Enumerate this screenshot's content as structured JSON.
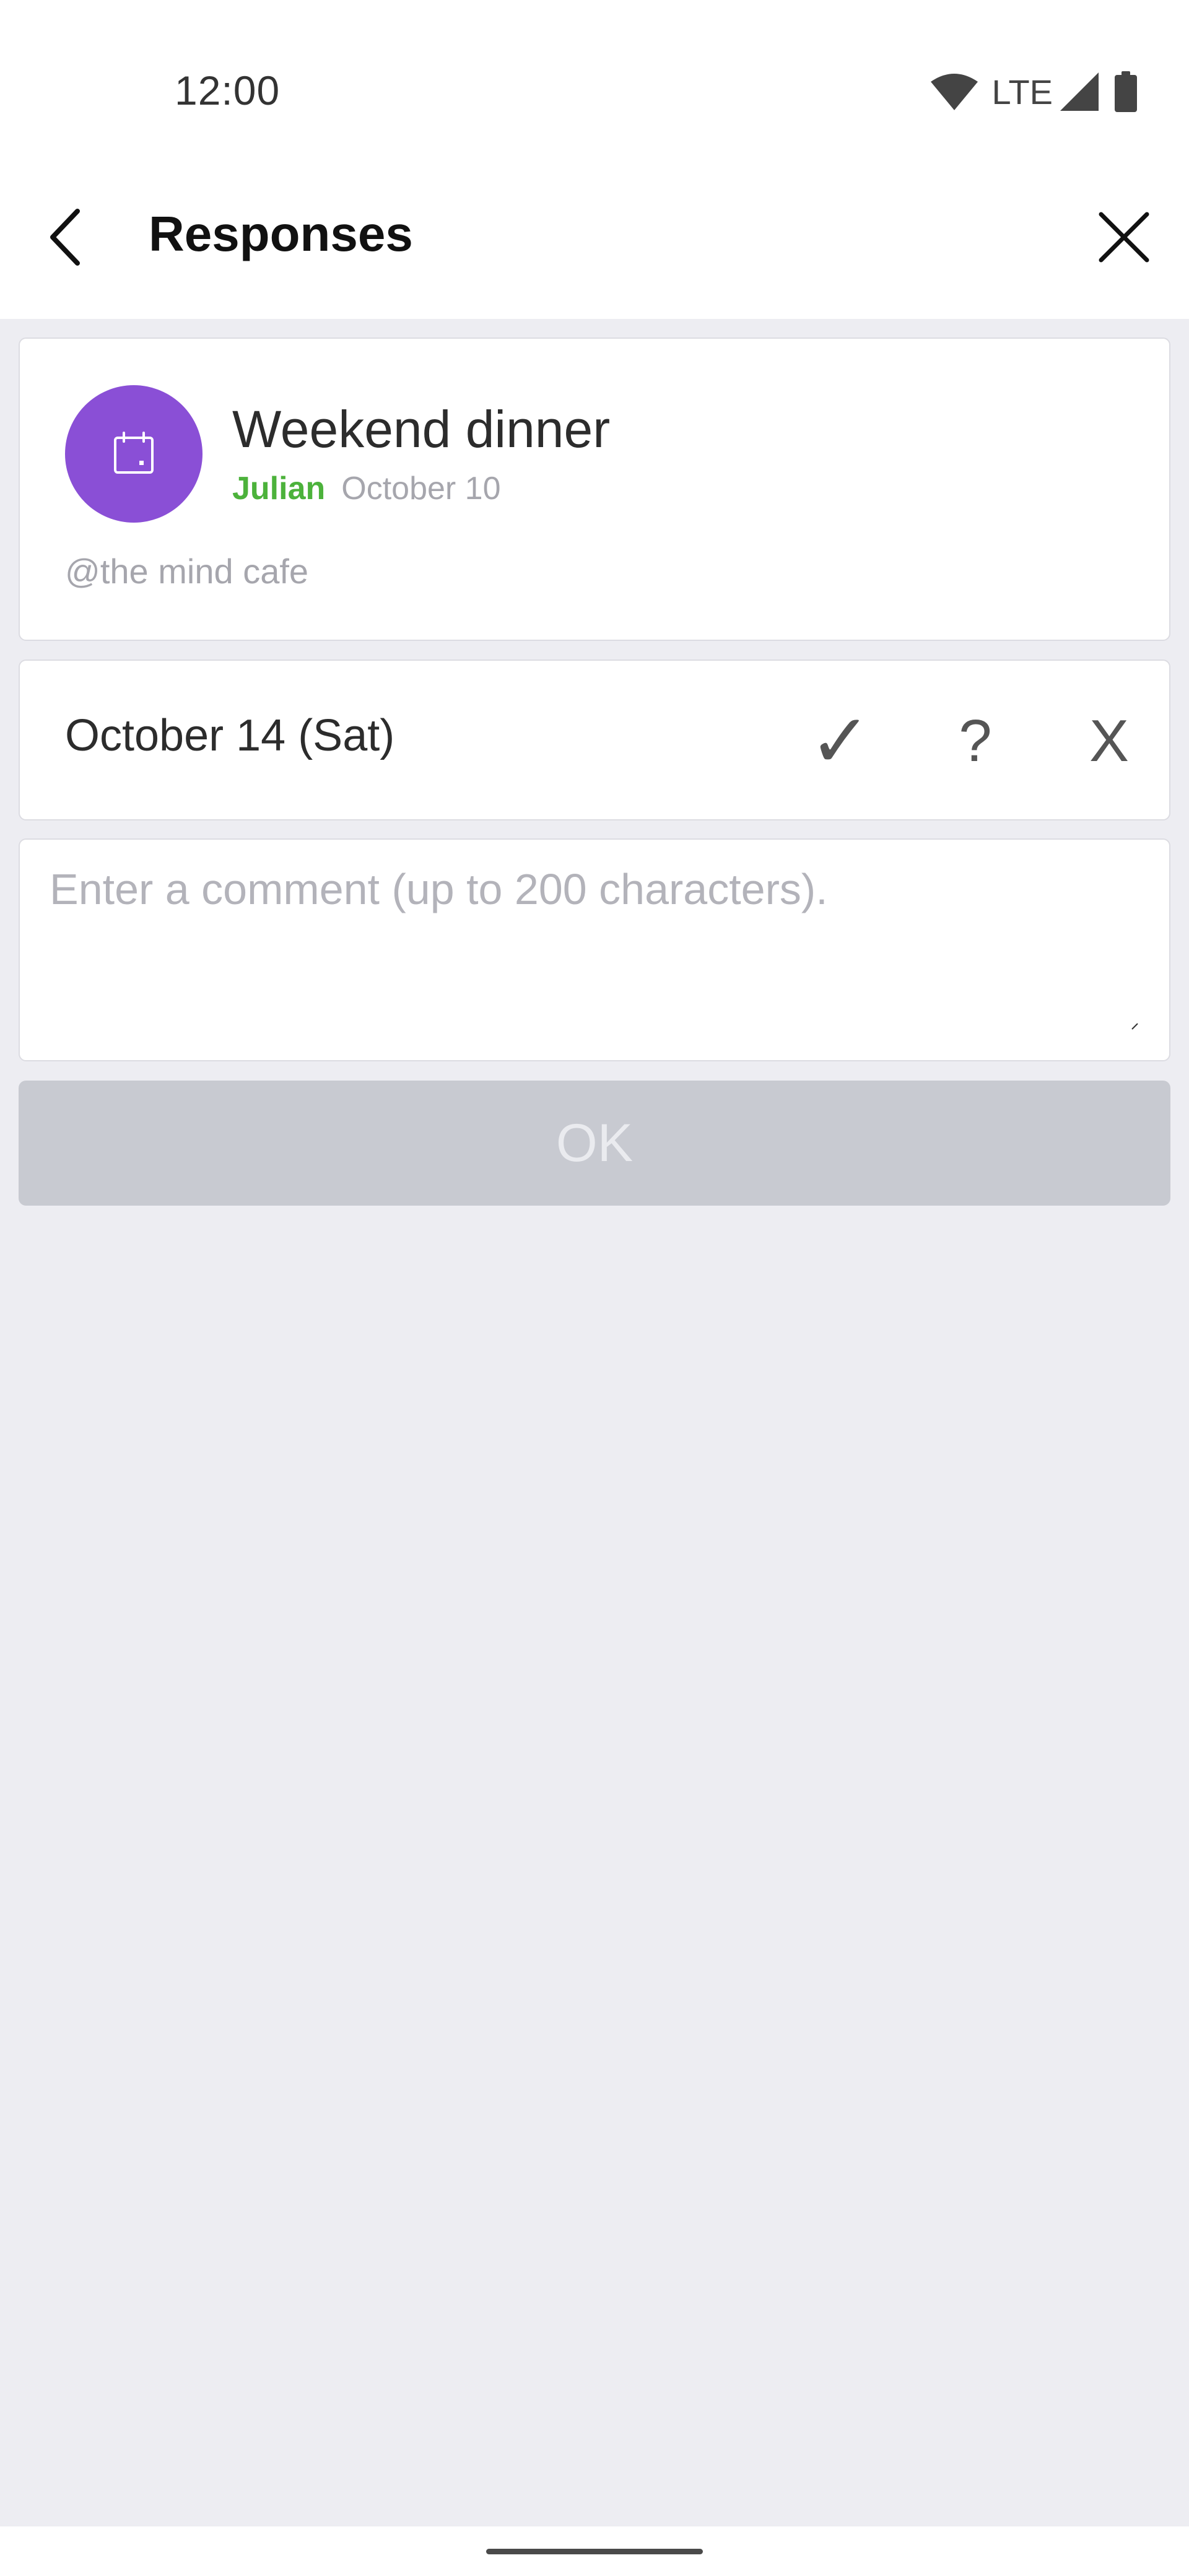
{
  "status_bar": {
    "time": "12:00",
    "network": "LTE",
    "icons": [
      "wifi-icon",
      "cell-signal-icon",
      "battery-icon"
    ]
  },
  "toolbar": {
    "title": "Responses",
    "back_icon": "chevron-left-icon",
    "close_icon": "close-icon"
  },
  "event": {
    "title": "Weekend dinner",
    "author": "Julian",
    "date": "October 10",
    "location": "@the mind cafe",
    "icon": "calendar-icon",
    "avatar_color": "#8a4fd6",
    "author_color": "#4cb23b"
  },
  "date_option": {
    "label": "October 14 (Sat)",
    "responses": {
      "yes": "✓",
      "maybe": "?",
      "no": "X"
    }
  },
  "comment": {
    "placeholder": "Enter a comment (up to 200 characters).",
    "value": ""
  },
  "ok_button": {
    "label": "OK",
    "enabled": false
  }
}
